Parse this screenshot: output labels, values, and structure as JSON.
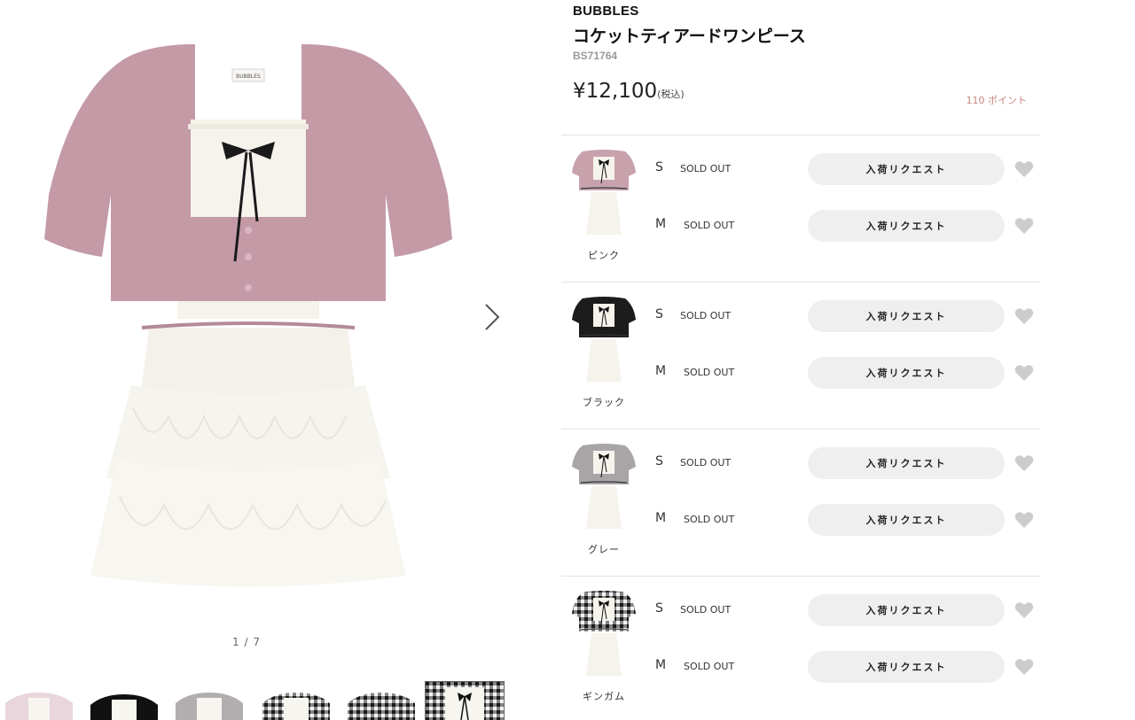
{
  "product": {
    "brand": "BUBBLES",
    "name": "コケットティアードワンピース",
    "code": "BS71764",
    "price": "¥12,100",
    "tax_note": "(税込)",
    "points": "110 ポイント"
  },
  "gallery": {
    "counter": "1 / 7",
    "main_image_label": "BUBBLES",
    "thumbnails": [
      "pink",
      "black",
      "gray",
      "gingham",
      "gingham-back",
      "gingham-detail"
    ]
  },
  "colors": [
    {
      "name": "ピンク",
      "swatch_color": "#c7a2ad",
      "sizes": [
        {
          "size": "S",
          "stock": "SOLD OUT",
          "button": "入荷リクエスト"
        },
        {
          "size": "M",
          "stock": "SOLD OUT",
          "button": "入荷リクエスト"
        }
      ]
    },
    {
      "name": "ブラック",
      "swatch_color": "#1c1c1c",
      "sizes": [
        {
          "size": "S",
          "stock": "SOLD OUT",
          "button": "入荷リクエスト"
        },
        {
          "size": "M",
          "stock": "SOLD OUT",
          "button": "入荷リクエスト"
        }
      ]
    },
    {
      "name": "グレー",
      "swatch_color": "#a9a5a7",
      "sizes": [
        {
          "size": "S",
          "stock": "SOLD OUT",
          "button": "入荷リクエスト"
        },
        {
          "size": "M",
          "stock": "SOLD OUT",
          "button": "入荷リクエスト"
        }
      ]
    },
    {
      "name": "ギンガム",
      "swatch_color": "#3a3a3a",
      "sizes": [
        {
          "size": "S",
          "stock": "SOLD OUT",
          "button": "入荷リクエスト"
        },
        {
          "size": "M",
          "stock": "SOLD OUT",
          "button": "入荷リクエスト"
        }
      ]
    }
  ],
  "icons": {
    "next": "chevron-right-icon",
    "favorite": "heart-icon"
  },
  "theme": {
    "points_color": "#c7867d",
    "button_bg": "#efefef",
    "heart_color": "#cccccc",
    "divider": "#e3e3e3"
  }
}
